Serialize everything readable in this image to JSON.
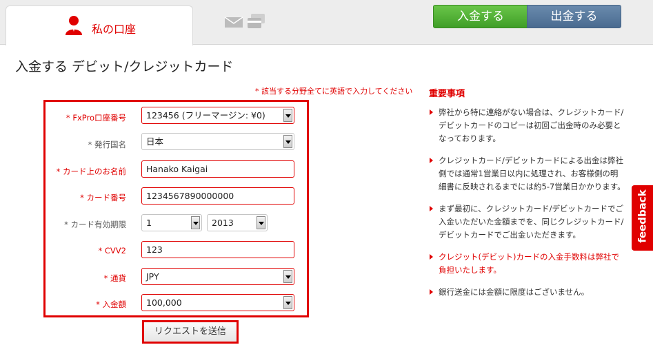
{
  "tabs": {
    "account_label": "私の口座"
  },
  "header_buttons": {
    "deposit": "入金する",
    "withdraw": "出金する"
  },
  "page_title": "入金する デビット/クレジットカード",
  "required_note": "* 該当する分野全てに英語で入力してください",
  "form": {
    "account": {
      "label": "* FxPro口座番号",
      "value": "123456 (フリーマージン: ¥0)"
    },
    "country": {
      "label": "* 発行国名",
      "value": "日本"
    },
    "name": {
      "label": "* カード上のお名前",
      "value": "Hanako Kaigai"
    },
    "card_number": {
      "label": "* カード番号",
      "value": "1234567890000000"
    },
    "expiry": {
      "label": "* カード有効期限",
      "month": "1",
      "year": "2013"
    },
    "cvv": {
      "label": "* CVV2",
      "value": "123"
    },
    "currency": {
      "label": "* 通貨",
      "value": "JPY"
    },
    "amount": {
      "label": "* 入金額",
      "value": "100,000"
    },
    "submit_label": "リクエストを送信"
  },
  "important": {
    "title": "重要事項",
    "notes": [
      "弊社から特に連絡がない場合は、クレジットカード/デビットカードのコピーは初回ご出金時のみ必要となっております。",
      "クレジットカード/デビットカードによる出金は弊社側では通常1営業日以内に処理され、お客様側の明細書に反映されるまでには約5-7営業日かかります。",
      "まず最初に、クレジットカード/デビットカードでご入金いただいた金額までを、同じクレジットカード/デビットカードでご出金いただきます。",
      "クレジット(デビット)カードの入金手数料は弊社で負担いたします。",
      "銀行送金には金額に限度はございません。"
    ]
  },
  "feedback_label": "feedback",
  "colors": {
    "accent": "#e00000",
    "deposit_green": "#4caf30",
    "withdraw_blue": "#5a7ba0"
  }
}
